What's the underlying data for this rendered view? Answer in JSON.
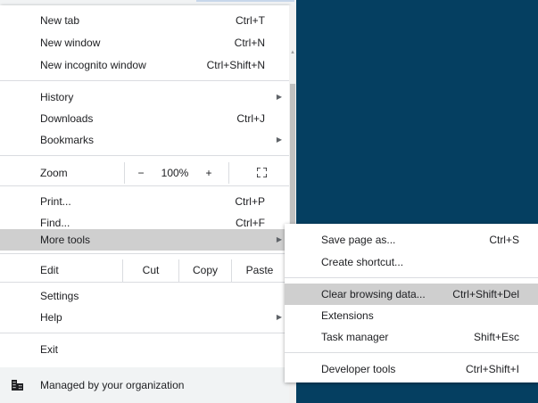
{
  "menu": {
    "new_tab": {
      "label": "New tab",
      "shortcut": "Ctrl+T"
    },
    "new_window": {
      "label": "New window",
      "shortcut": "Ctrl+N"
    },
    "new_incognito": {
      "label": "New incognito window",
      "shortcut": "Ctrl+Shift+N"
    },
    "history": {
      "label": "History"
    },
    "downloads": {
      "label": "Downloads",
      "shortcut": "Ctrl+J"
    },
    "bookmarks": {
      "label": "Bookmarks"
    },
    "zoom": {
      "label": "Zoom",
      "minus": "−",
      "value": "100%",
      "plus": "+",
      "fullscreen_icon": "fullscreen-icon"
    },
    "print": {
      "label": "Print...",
      "shortcut": "Ctrl+P"
    },
    "find": {
      "label": "Find...",
      "shortcut": "Ctrl+F"
    },
    "more_tools": {
      "label": "More tools"
    },
    "edit": {
      "label": "Edit",
      "cut": "Cut",
      "copy": "Copy",
      "paste": "Paste"
    },
    "settings": {
      "label": "Settings"
    },
    "help": {
      "label": "Help"
    },
    "exit": {
      "label": "Exit"
    },
    "managed": {
      "label": "Managed by your organization",
      "icon": "building-icon"
    },
    "submenu_arrow": "▶"
  },
  "submenu": {
    "save_page": {
      "label": "Save page as...",
      "shortcut": "Ctrl+S"
    },
    "create_shortcut": {
      "label": "Create shortcut..."
    },
    "clear_browsing": {
      "label": "Clear browsing data...",
      "shortcut": "Ctrl+Shift+Del"
    },
    "extensions": {
      "label": "Extensions"
    },
    "task_manager": {
      "label": "Task manager",
      "shortcut": "Shift+Esc"
    },
    "developer_tools": {
      "label": "Developer tools",
      "shortcut": "Ctrl+Shift+I"
    }
  },
  "colors": {
    "background_panel": "#053f61",
    "highlight": "#cfcfcf",
    "separator": "#dadce0",
    "text": "#202124"
  }
}
